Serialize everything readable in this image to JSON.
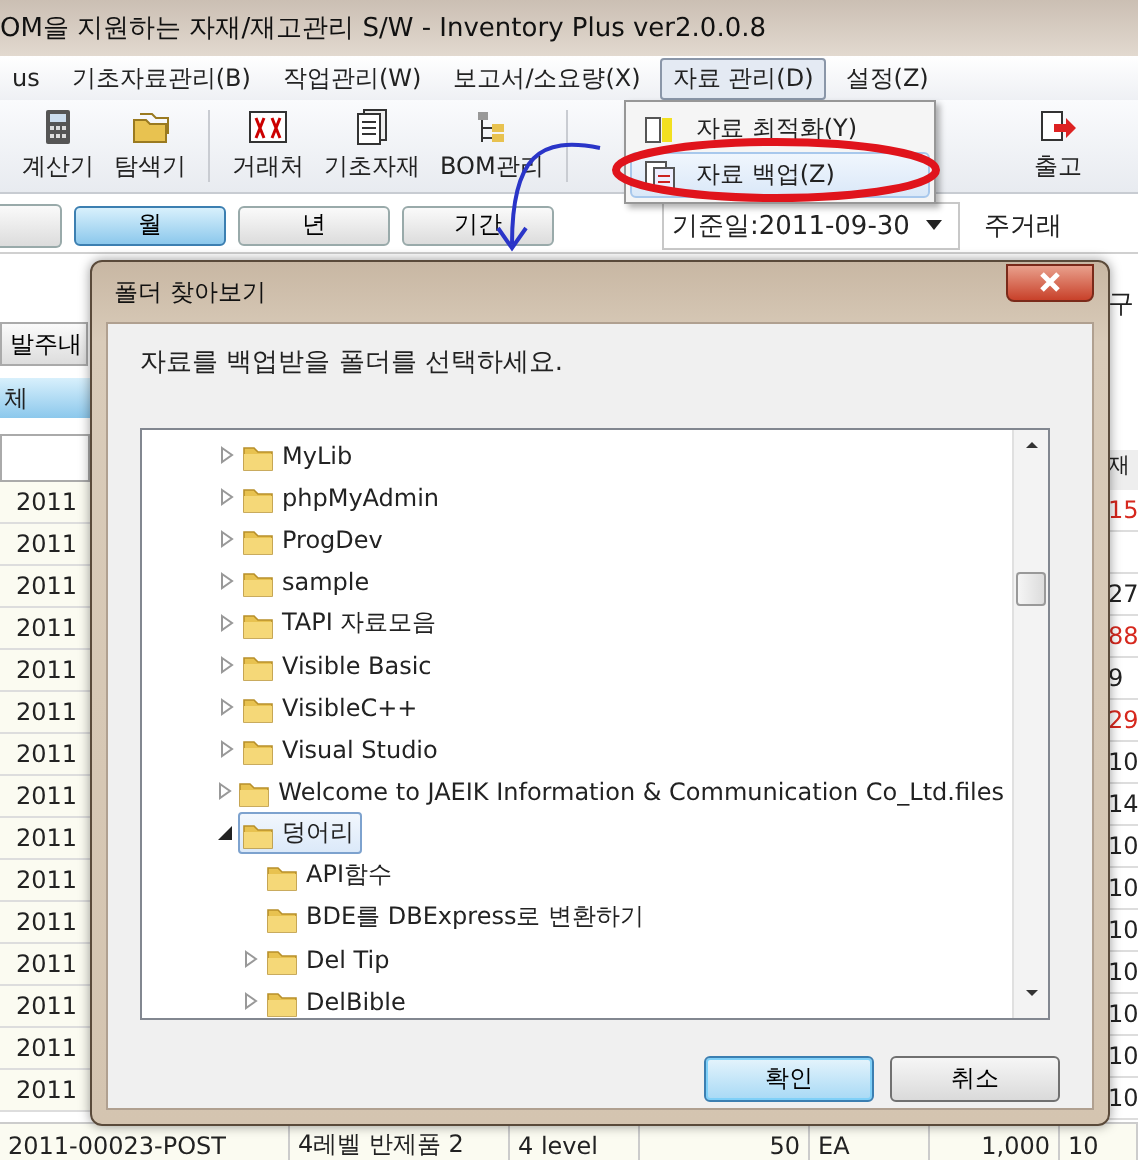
{
  "window": {
    "title": "OM을 지원하는 자재/재고관리 S/W - Inventory Plus ver2.0.0.8"
  },
  "menu": [
    {
      "label": "us",
      "selected": false
    },
    {
      "label": "기초자료관리(B)",
      "selected": false
    },
    {
      "label": "작업관리(W)",
      "selected": false
    },
    {
      "label": "보고서/소요량(X)",
      "selected": false
    },
    {
      "label": "자료 관리(D)",
      "selected": true
    },
    {
      "label": "설정(Z)",
      "selected": false
    }
  ],
  "toolbar": [
    {
      "label": "계산기"
    },
    {
      "label": "탐색기"
    },
    {
      "label": "거래처"
    },
    {
      "label": "기초자재"
    },
    {
      "label": "BOM관리"
    },
    {
      "label": "출고"
    }
  ],
  "dropdown": [
    {
      "label": "자료 최적화(Y)",
      "selected": false
    },
    {
      "label": "자료 백업(Z)",
      "selected": true
    }
  ],
  "periods": [
    {
      "label": "월",
      "selected": true
    },
    {
      "label": "년",
      "selected": false
    },
    {
      "label": "기간",
      "selected": false
    }
  ],
  "date_picker": {
    "value": "기준일:2011-09-30"
  },
  "vendor_label": "주거래",
  "left_panel": {
    "button": "발주내",
    "tab": "체",
    "rows": [
      "2011",
      "2011",
      "2011",
      "2011",
      "2011",
      "2011",
      "2011",
      "2011",
      "2011",
      "2011",
      "2011",
      "2011",
      "2011",
      "2011",
      "2011"
    ]
  },
  "right_panel": {
    "label": "구",
    "header": "재",
    "cells": [
      {
        "text": "15",
        "alert": true
      },
      {},
      {
        "text": "27",
        "alert": false
      },
      {
        "text": "88",
        "alert": true
      },
      {
        "text": "9",
        "alert": false
      },
      {
        "text": "29",
        "alert": true
      },
      {
        "text": "10",
        "alert": false
      },
      {
        "text": "14",
        "alert": false
      },
      {
        "text": "10",
        "alert": false
      },
      {
        "text": "10",
        "alert": false
      },
      {
        "text": "10",
        "alert": false
      },
      {
        "text": "10",
        "alert": false
      },
      {
        "text": "10",
        "alert": false
      },
      {
        "text": "10",
        "alert": false
      },
      {
        "text": "10",
        "alert": false
      }
    ]
  },
  "bottom_row": [
    "2011-00023-POST",
    "4레벨 반제품 2",
    "4 level",
    "50",
    "EA",
    "1,000",
    "10"
  ],
  "dialog": {
    "title": "폴더 찾아보기",
    "prompt": "자료를 백업받을 폴더를 선택하세요.",
    "tree": [
      {
        "label": "MyLib",
        "expandable": true,
        "expanded": false,
        "selected": false
      },
      {
        "label": "phpMyAdmin",
        "expandable": true,
        "expanded": false,
        "selected": false
      },
      {
        "label": "ProgDev",
        "expandable": true,
        "expanded": false,
        "selected": false
      },
      {
        "label": "sample",
        "expandable": true,
        "expanded": false,
        "selected": false
      },
      {
        "label": "TAPI 자료모음",
        "expandable": true,
        "expanded": false,
        "selected": false
      },
      {
        "label": "Visible Basic",
        "expandable": true,
        "expanded": false,
        "selected": false
      },
      {
        "label": "VisibleC++",
        "expandable": true,
        "expanded": false,
        "selected": false
      },
      {
        "label": "Visual Studio",
        "expandable": true,
        "expanded": false,
        "selected": false
      },
      {
        "label": "Welcome to JAEIK Information & Communication Co_Ltd.files",
        "expandable": true,
        "expanded": false,
        "selected": false
      },
      {
        "label": "덩어리",
        "expandable": true,
        "expanded": true,
        "selected": true,
        "children": [
          {
            "label": "API함수",
            "expandable": false,
            "selected": false
          },
          {
            "label": "BDE를 DBExpress로 변환하기",
            "expandable": false,
            "selected": false
          },
          {
            "label": "Del Tip",
            "expandable": true,
            "expanded": false,
            "selected": false
          },
          {
            "label": "DelBible",
            "expandable": true,
            "expanded": false,
            "selected": false
          }
        ]
      }
    ],
    "buttons": [
      {
        "label": "확인",
        "default": true
      },
      {
        "label": "취소",
        "default": false
      }
    ]
  }
}
